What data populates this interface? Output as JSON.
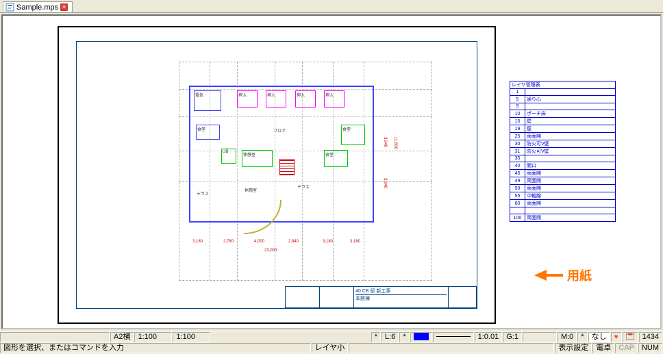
{
  "tab": {
    "filename": "Sample.mps"
  },
  "annotation": {
    "label": "用紙"
  },
  "titleBlock": {
    "t1": "40 CB 邸 新工事",
    "t2": "本館棟"
  },
  "rooms": {
    "r1": "電気",
    "r2": "押入",
    "r3": "押入",
    "r4": "押入",
    "r5": "押入",
    "r6": "食堂",
    "r7": "フロア",
    "r8": "食堂",
    "r9": "UB",
    "r10": "休憩室",
    "r11": "食堂",
    "r12": "テラス",
    "r13": "休憩室",
    "r14": "テラス"
  },
  "dimsH": [
    "3,180",
    "2,780",
    "4,000",
    "2,940",
    "3,180",
    "3,180"
  ],
  "dimsTotal": "23,000",
  "dimsV": [
    "3,940",
    "3,940",
    "11,600"
  ],
  "layerTable": {
    "header": "レイヤ管理表",
    "rows": [
      {
        "n": "1",
        "name": ""
      },
      {
        "n": "5",
        "name": "通り心"
      },
      {
        "n": "9",
        "name": ""
      },
      {
        "n": "10",
        "name": "ポーチ床"
      },
      {
        "n": "15",
        "name": "壁"
      },
      {
        "n": "19",
        "name": "壁"
      },
      {
        "n": "25",
        "name": "両面開"
      },
      {
        "n": "30",
        "name": "防火可V壁"
      },
      {
        "n": "31",
        "name": "防火可V壁"
      },
      {
        "n": "35",
        "name": ""
      },
      {
        "n": "40",
        "name": "開口"
      },
      {
        "n": "45",
        "name": "両面開"
      },
      {
        "n": "49",
        "name": "両面開"
      },
      {
        "n": "50",
        "name": "両面開"
      },
      {
        "n": "55",
        "name": "中軸線"
      },
      {
        "n": "60",
        "name": "両面開"
      },
      {
        "n": "",
        "name": ""
      },
      {
        "n": "100",
        "name": "両面開"
      }
    ]
  },
  "status": {
    "paperSize": "A2横",
    "scale1": "1:100",
    "scale2": "1:100",
    "layer": "L:6",
    "lineScale": "1:0.01",
    "grid": "G:1",
    "m": "M:0",
    "none": "なし",
    "count": "1434",
    "prompt": "図形を選択、またはコマンドを入力",
    "layerSmall": "レイヤ小",
    "dispSettings": "表示設定",
    "calc": "電卓",
    "cap": "CAP",
    "num": "NUM",
    "star": "*"
  }
}
